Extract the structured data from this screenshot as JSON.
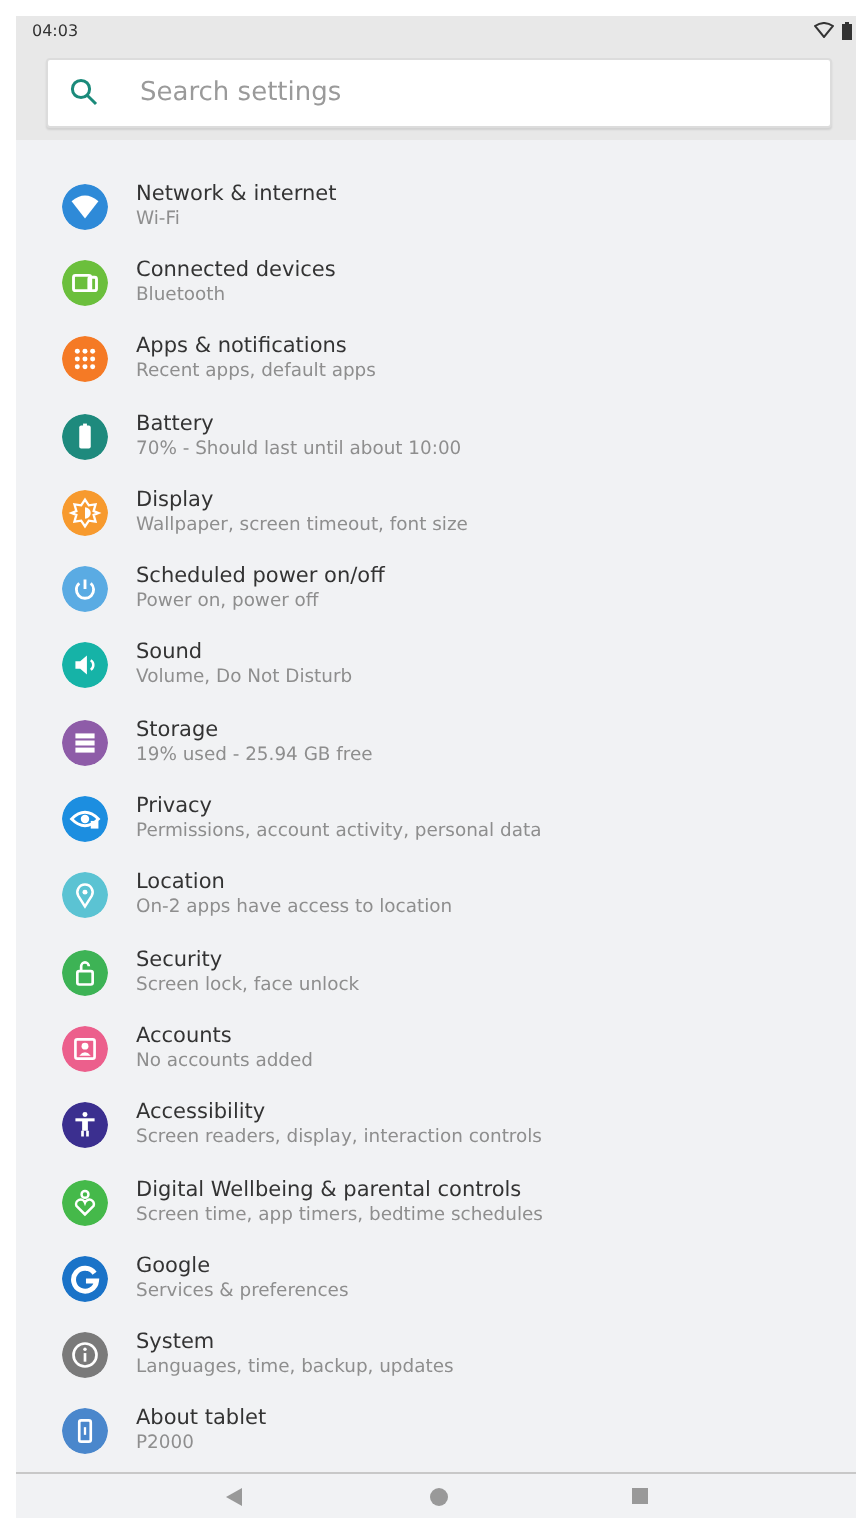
{
  "status_bar": {
    "time": "04:03"
  },
  "search": {
    "placeholder": "Search settings"
  },
  "items": [
    {
      "title": "Network & internet",
      "subtitle": "Wi-Fi",
      "color": "#2e8ad8"
    },
    {
      "title": "Connected devices",
      "subtitle": "Bluetooth",
      "color": "#6bbf3c"
    },
    {
      "title": "Apps & notifications",
      "subtitle": "Recent apps, default apps",
      "color": "#f57a25"
    },
    {
      "title": "Battery",
      "subtitle": "70% - Should last until about 10:00",
      "color": "#1e8a7d"
    },
    {
      "title": "Display",
      "subtitle": "Wallpaper, screen timeout, font size",
      "color": "#f79a2e"
    },
    {
      "title": "Scheduled power on/off",
      "subtitle": "Power on, power off",
      "color": "#5aabe3"
    },
    {
      "title": "Sound",
      "subtitle": "Volume, Do Not Disturb",
      "color": "#16b3a7"
    },
    {
      "title": "Storage",
      "subtitle": "19% used - 25.94 GB free",
      "color": "#8e5ca8"
    },
    {
      "title": "Privacy",
      "subtitle": "Permissions, account activity, personal data",
      "color": "#1c8ee0"
    },
    {
      "title": "Location",
      "subtitle": "On-2 apps have access to location",
      "color": "#5bc3d3"
    },
    {
      "title": "Security",
      "subtitle": "Screen lock, face unlock",
      "color": "#3db355"
    },
    {
      "title": "Accounts",
      "subtitle": "No accounts added",
      "color": "#ec5f8c"
    },
    {
      "title": "Accessibility",
      "subtitle": "Screen readers, display, interaction controls",
      "color": "#3b2f8f"
    },
    {
      "title": "Digital Wellbeing & parental controls",
      "subtitle": "Screen time, app timers, bedtime schedules",
      "color": "#45b94a"
    },
    {
      "title": "Google",
      "subtitle": "Services & preferences",
      "color": "#1a73c8"
    },
    {
      "title": "System",
      "subtitle": "Languages, time, backup, updates",
      "color": "#7a7a7a"
    },
    {
      "title": "About tablet",
      "subtitle": "P2000",
      "color": "#4a87cc"
    }
  ]
}
